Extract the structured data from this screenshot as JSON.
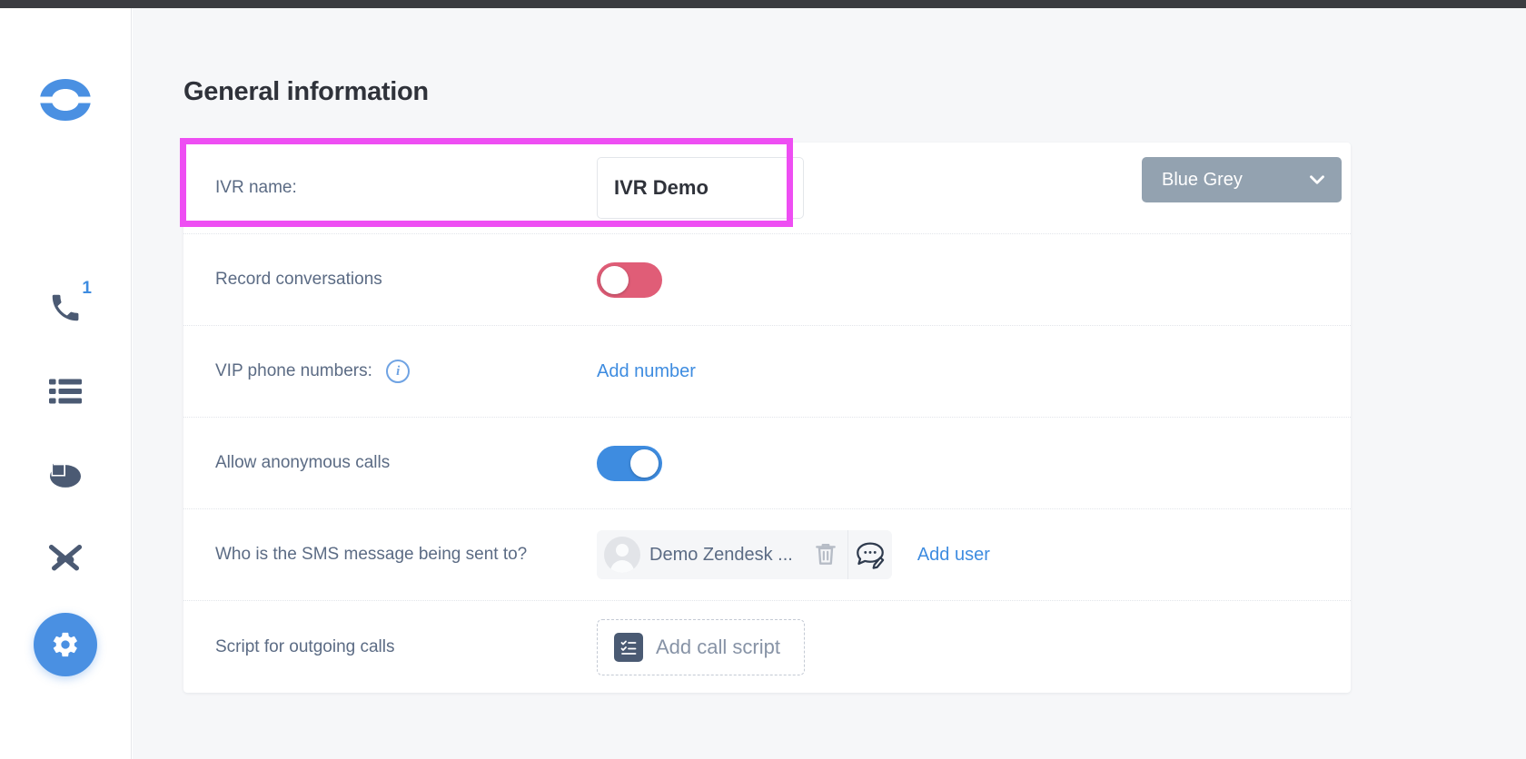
{
  "window": {
    "topbar_color": "#3b3c41",
    "background": "#f6f7f9"
  },
  "sidebar": {
    "logo_name": "ringover-logo",
    "items": [
      {
        "name": "phone-icon",
        "label": "Calls",
        "badge": "1"
      },
      {
        "name": "list-icon",
        "label": "Call logs",
        "badge": ""
      },
      {
        "name": "pie-chart-icon",
        "label": "Statistics",
        "badge": ""
      },
      {
        "name": "scissors-icon",
        "label": "Integrations",
        "badge": ""
      }
    ],
    "settings": {
      "name": "gear-icon",
      "label": "Settings"
    }
  },
  "main": {
    "title": "General information",
    "highlight_color": "#ee4ef3",
    "rows": [
      {
        "label": "IVR name:",
        "input_value": "IVR Demo",
        "input_placeholder": "IVR name",
        "color_select": {
          "value": "Blue Grey",
          "chevron": "chevron-down-icon"
        }
      },
      {
        "label": "Record conversations",
        "toggle": {
          "state": "off",
          "color": "#e05d77"
        }
      },
      {
        "label": "VIP phone numbers:",
        "info_icon": "info-icon",
        "info_glyph": "i",
        "link": "Add number"
      },
      {
        "label": "Allow anonymous calls",
        "toggle": {
          "state": "on",
          "color": "#3e8ce0"
        }
      },
      {
        "label": "Who is the SMS message being sent to?",
        "chip": {
          "avatar": "user-avatar",
          "name": "Demo Zendesk ...",
          "delete_icon": "trash-icon",
          "message_icon": "message-edit-icon"
        },
        "link": "Add user"
      },
      {
        "label": "Script for outgoing calls",
        "button": {
          "icon": "task-list-icon",
          "label": "Add call script"
        }
      }
    ]
  }
}
